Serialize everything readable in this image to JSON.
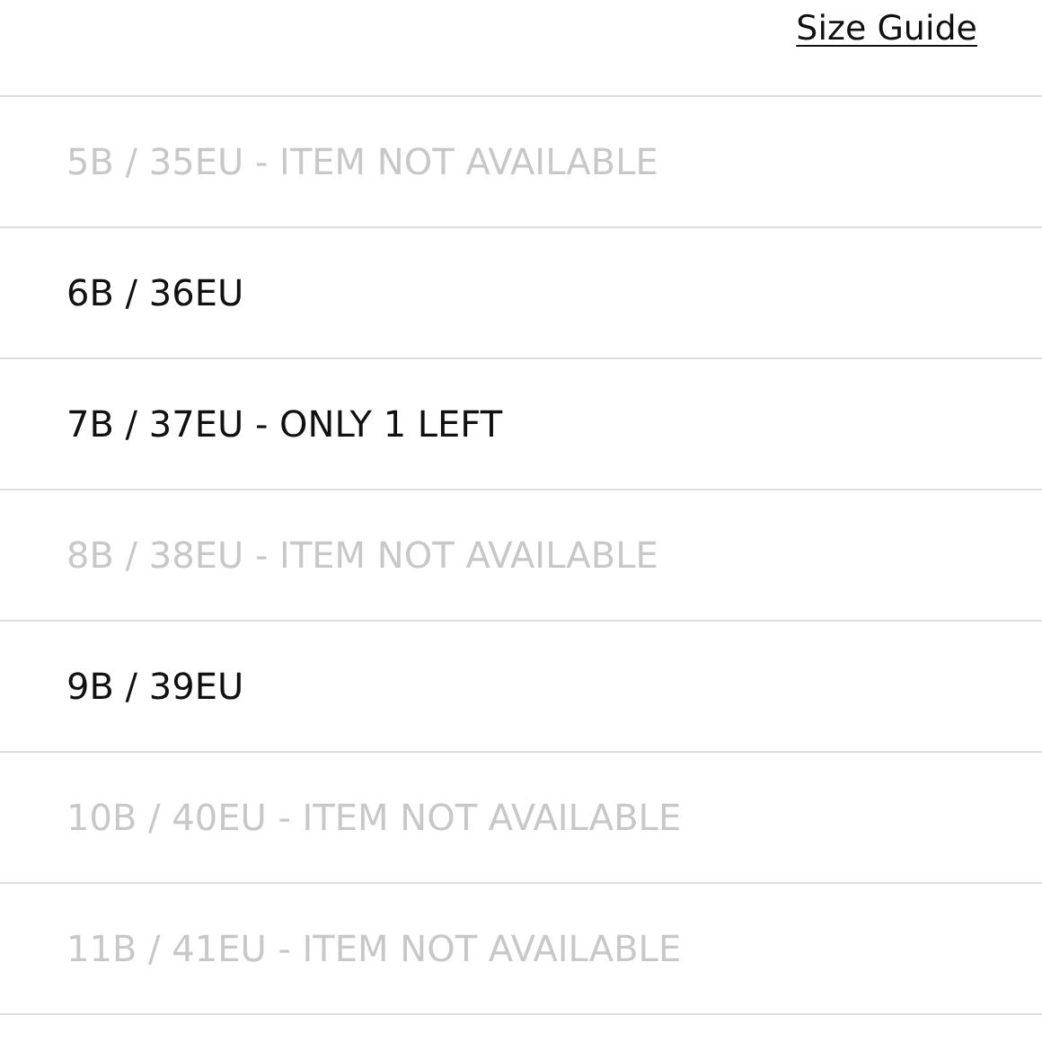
{
  "size_guide_link": "Size Guide",
  "sizes": [
    {
      "label": "5B / 35EU - ITEM NOT AVAILABLE",
      "available": false
    },
    {
      "label": "6B / 36EU",
      "available": true
    },
    {
      "label": "7B / 37EU - ONLY 1 LEFT",
      "available": true
    },
    {
      "label": "8B / 38EU - ITEM NOT AVAILABLE",
      "available": false
    },
    {
      "label": "9B / 39EU",
      "available": true
    },
    {
      "label": "10B / 40EU - ITEM NOT AVAILABLE",
      "available": false
    },
    {
      "label": "11B / 41EU - ITEM NOT AVAILABLE",
      "available": false
    }
  ]
}
